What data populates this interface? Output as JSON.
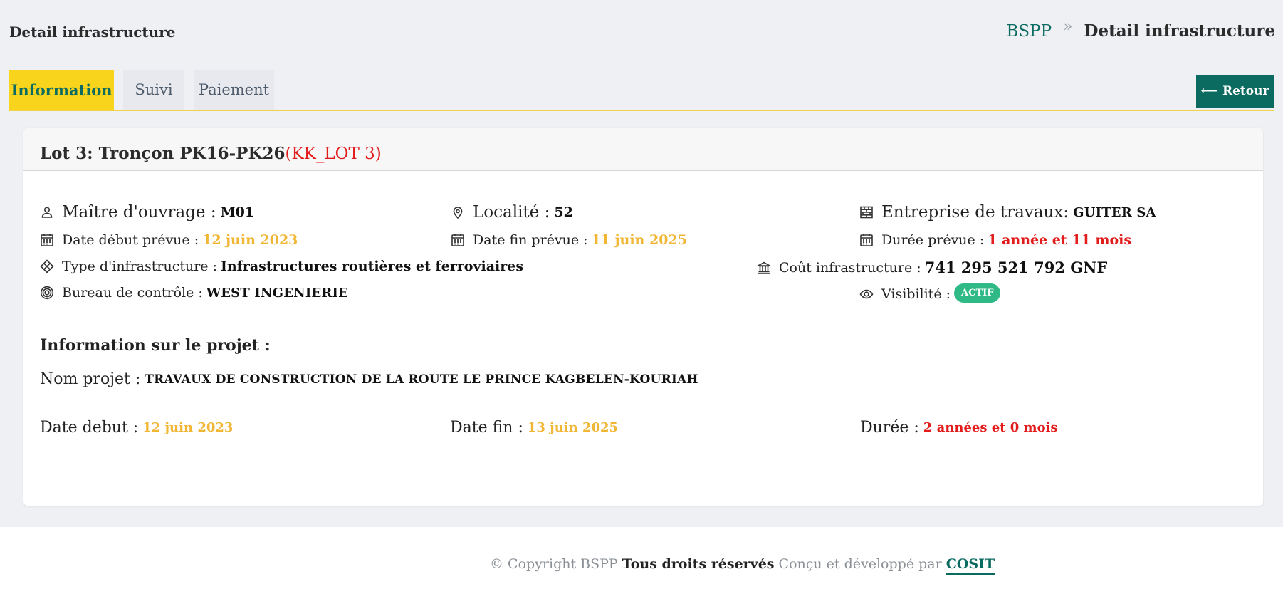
{
  "header": {
    "page_title": "Detail infrastructure",
    "breadcrumb": {
      "home": "BSPP",
      "separator": "»",
      "current": "Detail infrastructure"
    }
  },
  "tabs": [
    {
      "label": "Information",
      "active": true
    },
    {
      "label": "Suivi",
      "active": false
    },
    {
      "label": "Paiement",
      "active": false
    }
  ],
  "retour_button": {
    "arrow": "⟵",
    "label": "Retour"
  },
  "card": {
    "title": "Lot 3: Tronçon PK16-PK26",
    "code": "(KK_LOT 3)",
    "fields": {
      "maitre_ouvrage": {
        "label": "Maître d'ouvrage :",
        "value": "M01",
        "icon": "user-icon"
      },
      "localite": {
        "label": "Localité :",
        "value": "52",
        "icon": "map-pin-icon"
      },
      "entreprise": {
        "label": "Entreprise de travaux:",
        "value": "GUITER SA",
        "icon": "brick-wall-icon"
      },
      "date_debut_prevue": {
        "label": "Date début prévue :",
        "value": "12 juin 2023",
        "icon": "calendar-icon"
      },
      "date_fin_prevue": {
        "label": "Date fin prévue :",
        "value": "11 juin 2025",
        "icon": "calendar-icon"
      },
      "duree_prevue": {
        "label": "Durée prévue :",
        "value": "1 année et 11 mois",
        "icon": "calendar-icon"
      },
      "type_infrastructure": {
        "label": "Type d'infrastructure :",
        "value": "Infrastructures routières et ferroviaires",
        "icon": "diamond-icon"
      },
      "cout_infrastructure": {
        "label": "Coût infrastructure :",
        "value": "741 295 521 792 GNF",
        "icon": "bank-icon"
      },
      "bureau_controle": {
        "label": "Bureau de contrôle :",
        "value": "WEST INGENIERIE",
        "icon": "target-icon"
      },
      "visibilite": {
        "label": "Visibilité :",
        "value": "ACTIF",
        "icon": "eye-icon"
      }
    },
    "project": {
      "section_title": "Information sur le projet :",
      "nom_label": "Nom projet :",
      "nom_value": "TRAVAUX DE CONSTRUCTION DE LA ROUTE LE PRINCE KAGBELEN-KOURIAH",
      "date_debut_label": "Date debut :",
      "date_debut_value": "12 juin 2023",
      "date_fin_label": "Date fin :",
      "date_fin_value": "13 juin 2025",
      "duree_label": "Durée :",
      "duree_value": "2 années et 0 mois"
    }
  },
  "footer": {
    "copyright": "© Copyright BSPP",
    "rights": "Tous droits réservés",
    "designed": "Conçu et développé par",
    "company": "COSIT"
  },
  "colors": {
    "accent_teal": "#0c6b61",
    "tab_active_yellow": "#f9d41c",
    "date_yellow": "#f1b634",
    "alert_red": "#e21b1b",
    "badge_green": "#2fb986"
  }
}
